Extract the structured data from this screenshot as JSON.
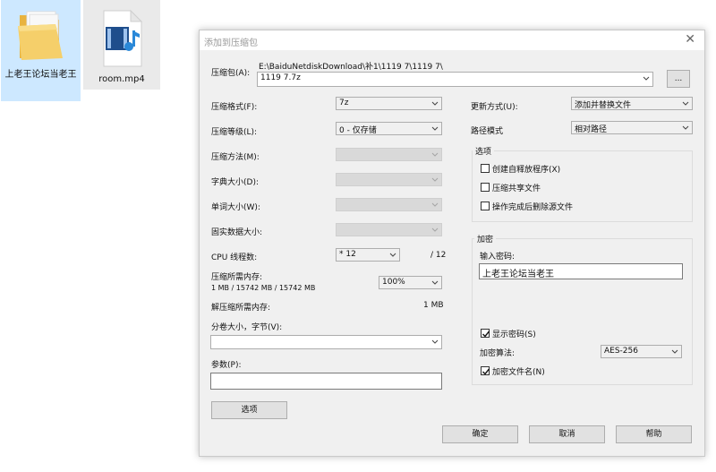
{
  "desktop": {
    "icons": [
      {
        "name": "上老王论坛当老王",
        "type": "folder"
      },
      {
        "name": "room.mp4",
        "type": "video-file"
      }
    ]
  },
  "dialog": {
    "title": "添加到压缩包",
    "archive": {
      "label": "压缩包(A):",
      "path": "E:\\BaiduNetdiskDownload\\补1\\1119 7\\1119 7\\",
      "value": "1119 7.7z",
      "browse": "..."
    },
    "left": {
      "format": {
        "label": "压缩格式(F):",
        "value": "7z"
      },
      "level": {
        "label": "压缩等级(L):",
        "value": "0 - 仅存储"
      },
      "method": {
        "label": "压缩方法(M):",
        "value": ""
      },
      "dict": {
        "label": "字典大小(D):",
        "value": ""
      },
      "word": {
        "label": "单词大小(W):",
        "value": ""
      },
      "solid": {
        "label": "固实数据大小:",
        "value": ""
      },
      "threads": {
        "label": "CPU 线程数:",
        "value": "* 12",
        "max": "/ 12"
      },
      "mem_compress": {
        "label": "压缩所需内存:",
        "detail": "1 MB / 15742 MB / 15742 MB",
        "percent": "100%"
      },
      "mem_decompress": {
        "label": "解压缩所需内存:",
        "value": "1 MB"
      },
      "volume": {
        "label": "分卷大小，字节(V):",
        "value": ""
      },
      "params": {
        "label": "参数(P):",
        "value": ""
      },
      "options_button": "选项"
    },
    "right": {
      "update": {
        "label": "更新方式(U):",
        "value": "添加并替换文件"
      },
      "path_mode": {
        "label": "路径模式",
        "value": "相对路径"
      },
      "options": {
        "title": "选项",
        "sfx": {
          "label": "创建自释放程序(X)",
          "checked": false
        },
        "shared": {
          "label": "压缩共享文件",
          "checked": false
        },
        "delete": {
          "label": "操作完成后删除源文件",
          "checked": false
        }
      },
      "encryption": {
        "title": "加密",
        "password_label": "输入密码:",
        "password": "上老王论坛当老王",
        "show_password": {
          "label": "显示密码(S)",
          "checked": true
        },
        "method_label": "加密算法:",
        "method": "AES-256",
        "encrypt_names": {
          "label": "加密文件名(N)",
          "checked": true
        }
      }
    },
    "buttons": {
      "ok": "确定",
      "cancel": "取消",
      "help": "帮助"
    }
  }
}
